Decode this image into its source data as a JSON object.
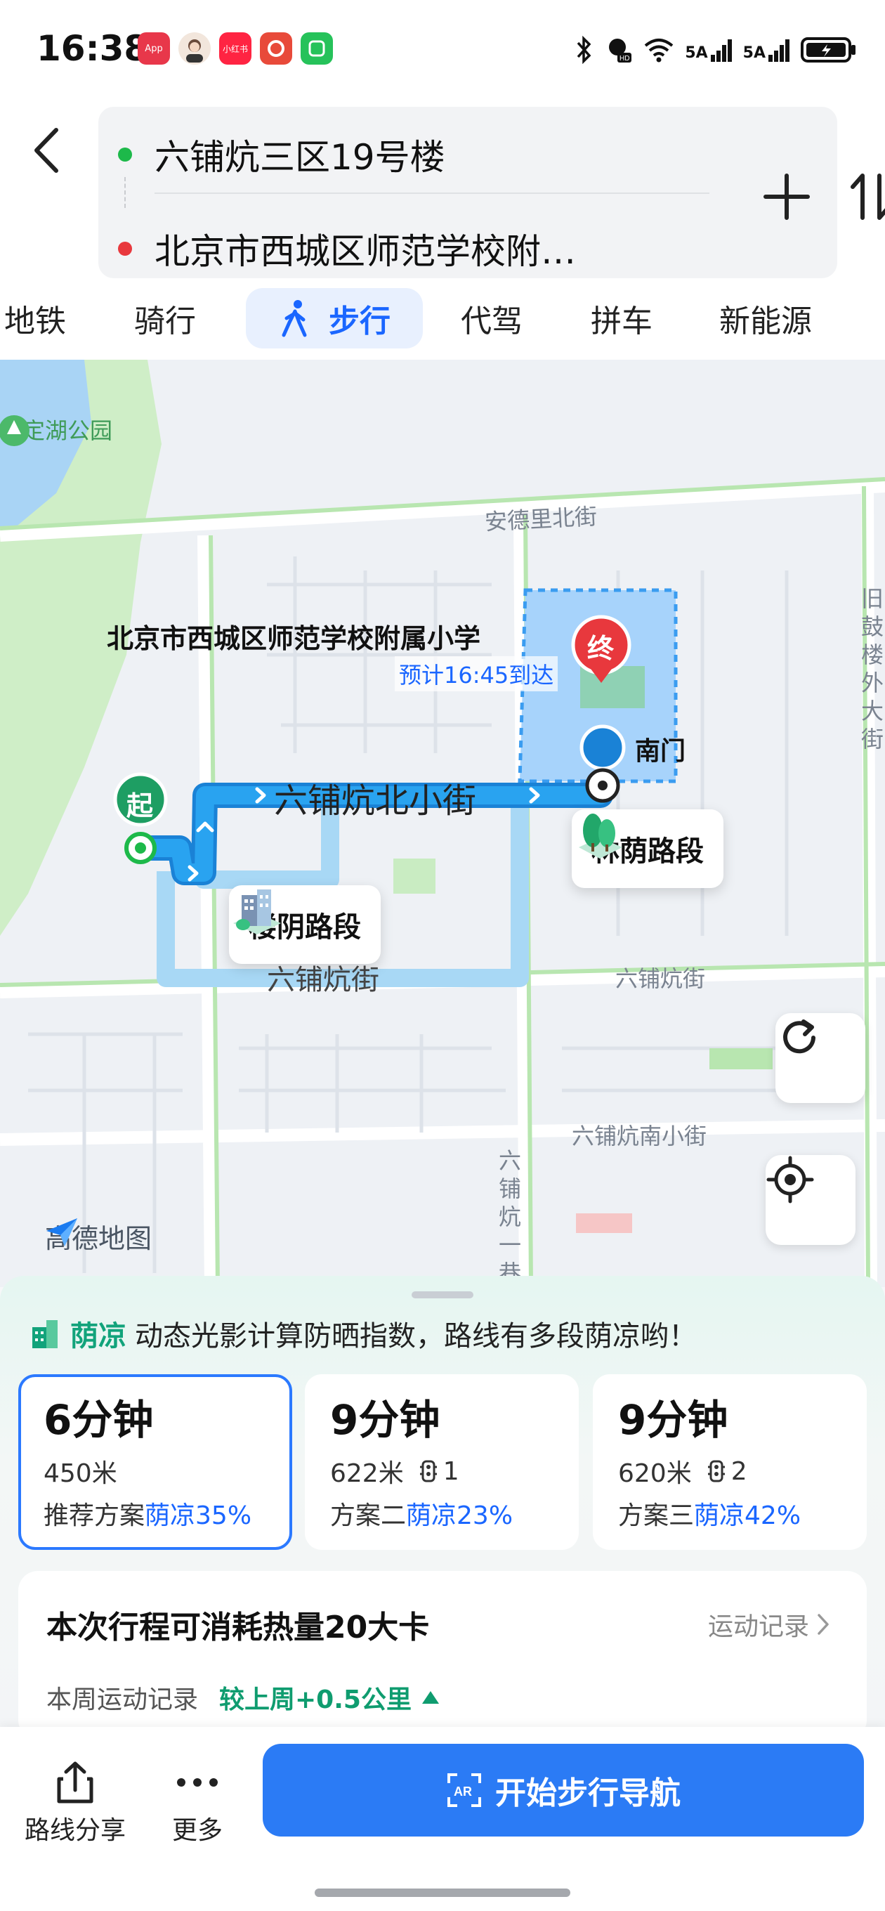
{
  "status_bar": {
    "time": "16:38",
    "apps": [
      "AppGallery",
      "avatar",
      "小红书",
      "app",
      "app"
    ],
    "signal_1": "5A",
    "signal_2": "5A"
  },
  "header": {
    "origin": "六铺炕三区19号楼",
    "destination": "北京市西城区师范学校附…",
    "modes": [
      "地铁",
      "骑行",
      "步行",
      "代驾",
      "拼车",
      "新能源"
    ],
    "active_mode": "步行"
  },
  "map": {
    "park_label": "人定湖公园",
    "street_north": "安德里北街",
    "street_route": "六铺炕北小街",
    "street_south": "六铺炕街",
    "street_south_right": "六铺炕街",
    "street_far_south": "六铺炕南小街",
    "street_vertical": "六铺炕一巷",
    "street_right_edge": "旧鼓楼外大街",
    "destination_name": "北京市西城区师范学校附属小学",
    "eta": "预计16:45到达",
    "end_marker": "终",
    "start_marker": "起",
    "gate_label": "南门",
    "callout_shade": "林荫路段",
    "callout_building": "楼阴路段",
    "brand": "高德地图"
  },
  "sheet": {
    "tip_tag": "荫凉",
    "tip_text": "动态光影计算防晒指数，路线有多段荫凉哟！",
    "plans": [
      {
        "time": "6分钟",
        "distance": "450米",
        "lights": "",
        "name": "推荐方案",
        "shade": "荫凉35%"
      },
      {
        "time": "9分钟",
        "distance": "622米",
        "lights": "1",
        "name": "方案二",
        "shade": "荫凉23%"
      },
      {
        "time": "9分钟",
        "distance": "620米",
        "lights": "2",
        "name": "方案三",
        "shade": "荫凉42%"
      }
    ],
    "calorie_title": "本次行程可消耗热量20大卡",
    "calorie_link": "运动记录",
    "week_label": "本周运动记录",
    "week_delta": "较上周+0.5公里"
  },
  "actions": {
    "share": "路线分享",
    "more": "更多",
    "start": "开始步行导航"
  },
  "colors": {
    "accent": "#2b7bf5",
    "route": "#29a3f0",
    "shade_green": "#12a37b",
    "origin_dot": "#1db94a",
    "dest_dot": "#e8383d"
  }
}
